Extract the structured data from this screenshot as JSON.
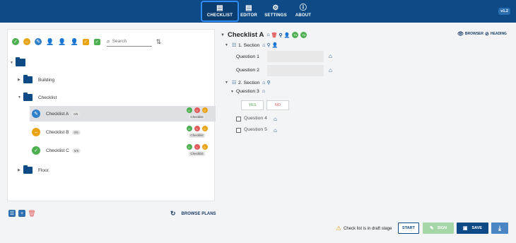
{
  "nav": {
    "items": [
      {
        "label": "CHECKLIST",
        "icon": "checklist-icon"
      },
      {
        "label": "EDITOR",
        "icon": "editor-icon"
      },
      {
        "label": "SETTINGS",
        "icon": "gear-icon"
      },
      {
        "label": "ABOUT",
        "icon": "info-icon"
      }
    ],
    "active": "CHECKLIST",
    "version": "v1.2"
  },
  "toolbar": {
    "search_placeholder": "Search"
  },
  "tree": {
    "folders": [
      "Building",
      "Checklist",
      "Floor"
    ],
    "items": [
      {
        "name": "Checklist A",
        "badge": "0/5",
        "status_color": "#2f80c8",
        "tag": "Checklist",
        "dots": [
          {
            "t": "0",
            "c": "#4caf50"
          },
          {
            "t": "0",
            "c": "#e05a5a"
          },
          {
            "t": "0",
            "c": "#e8a317"
          }
        ]
      },
      {
        "name": "Checklist B",
        "badge": "0/5",
        "status_color": "#e8a317",
        "tag": "Checklist",
        "dots": [
          {
            "t": "0",
            "c": "#4caf50"
          },
          {
            "t": "0",
            "c": "#e05a5a"
          },
          {
            "t": "0",
            "c": "#e8a317"
          }
        ]
      },
      {
        "name": "Checklist C",
        "badge": "5/5",
        "status_color": "#4caf50",
        "tag": "Checklist",
        "dots": [
          {
            "t": "0",
            "c": "#4caf50"
          },
          {
            "t": "1",
            "c": "#e05a5a"
          },
          {
            "t": "0",
            "c": "#e8a317"
          }
        ]
      }
    ]
  },
  "browse_label": "BROWSE PLANS",
  "detail": {
    "title": "Checklist A",
    "avatars": [
      "T1",
      "T1"
    ],
    "browser_label": "BROWSER",
    "heading_label": "HEADING",
    "section1": "1. Section",
    "q1": "Question 1",
    "q2": "Question 2",
    "section2": "2. Section",
    "q3": "Question 3",
    "yes": "YES",
    "no": "NO",
    "q4": "Question 4",
    "q5": "Question 5"
  },
  "footer": {
    "draft_note": "Check list is in draft stage",
    "start": "START",
    "sign": "SIGN",
    "save": "SAVE"
  },
  "colors": {
    "primary": "#0d4a86",
    "green": "#4caf50",
    "red": "#e05a5a",
    "orange": "#e8a317"
  }
}
